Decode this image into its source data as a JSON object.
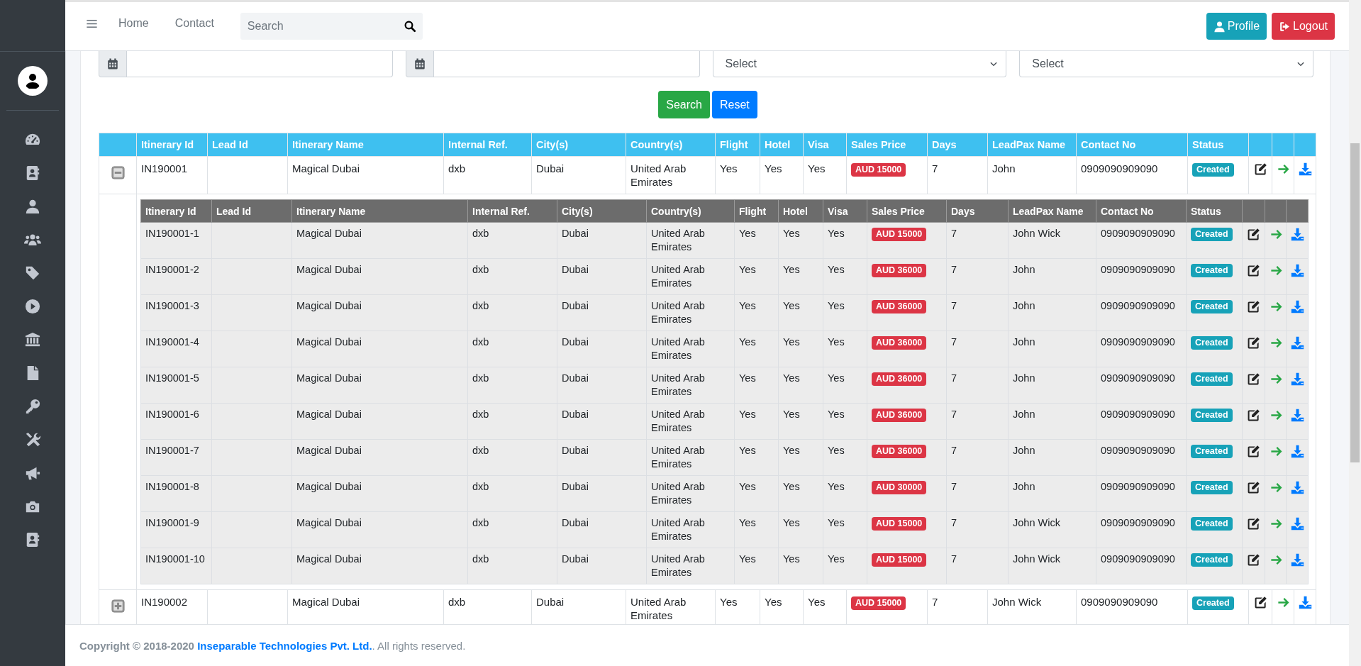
{
  "navbar": {
    "links": [
      "Home",
      "Contact"
    ],
    "search": {
      "placeholder": "Search"
    },
    "buttons": [
      {
        "label": "Profile",
        "kind": "profile"
      },
      {
        "label": "Logout",
        "kind": "logout"
      }
    ]
  },
  "filters": {
    "selects": [
      {
        "value": "Select"
      },
      {
        "value": "Select"
      }
    ],
    "buttons": [
      {
        "label": "Search",
        "kind": "search"
      },
      {
        "label": "Reset",
        "kind": "reset"
      }
    ]
  },
  "table": {
    "columns": [
      "Itinerary Id",
      "Lead Id",
      "Itinerary Name",
      "Internal Ref.",
      "City(s)",
      "Country(s)",
      "Flight",
      "Hotel",
      "Visa",
      "Sales Price",
      "Days",
      "LeadPax Name",
      "Contact No",
      "Status"
    ],
    "rows": [
      {
        "itinerary_id": "IN190001",
        "itinerary_name": "Magical Dubai",
        "internal_ref": "dxb",
        "cities": "Dubai",
        "country": "United Arab Emirates",
        "flight": "Yes",
        "hotel": "Yes",
        "visa": "Yes",
        "sales_price": "AUD 15000",
        "days": "7",
        "leadpax_name": "John",
        "contact_no": "0909090909090",
        "status": "Created",
        "expanded": true,
        "sub_table": {
          "columns": [
            "Itinerary Id",
            "Lead Id",
            "Itinerary Name",
            "Internal Ref.",
            "City(s)",
            "Country(s)",
            "Flight",
            "Hotel",
            "Visa",
            "Sales Price",
            "Days",
            "LeadPax Name",
            "Contact No",
            "Status"
          ],
          "rows": [
            {
              "itinerary_id": "IN190001-1",
              "itinerary_name": "Magical Dubai",
              "internal_ref": "dxb",
              "cities": "Dubai",
              "country": "United Arab Emirates",
              "flight": "Yes",
              "hotel": "Yes",
              "visa": "Yes",
              "sales_price": "AUD 15000",
              "days": "7",
              "leadpax_name": "John Wick",
              "contact_no": "0909090909090",
              "status": "Created"
            },
            {
              "itinerary_id": "IN190001-2",
              "itinerary_name": "Magical Dubai",
              "internal_ref": "dxb",
              "cities": "Dubai",
              "country": "United Arab Emirates",
              "flight": "Yes",
              "hotel": "Yes",
              "visa": "Yes",
              "sales_price": "AUD 36000",
              "days": "7",
              "leadpax_name": "John",
              "contact_no": "0909090909090",
              "status": "Created"
            },
            {
              "itinerary_id": "IN190001-3",
              "itinerary_name": "Magical Dubai",
              "internal_ref": "dxb",
              "cities": "Dubai",
              "country": "United Arab Emirates",
              "flight": "Yes",
              "hotel": "Yes",
              "visa": "Yes",
              "sales_price": "AUD 36000",
              "days": "7",
              "leadpax_name": "John",
              "contact_no": "0909090909090",
              "status": "Created"
            },
            {
              "itinerary_id": "IN190001-4",
              "itinerary_name": "Magical Dubai",
              "internal_ref": "dxb",
              "cities": "Dubai",
              "country": "United Arab Emirates",
              "flight": "Yes",
              "hotel": "Yes",
              "visa": "Yes",
              "sales_price": "AUD 36000",
              "days": "7",
              "leadpax_name": "John",
              "contact_no": "0909090909090",
              "status": "Created"
            },
            {
              "itinerary_id": "IN190001-5",
              "itinerary_name": "Magical Dubai",
              "internal_ref": "dxb",
              "cities": "Dubai",
              "country": "United Arab Emirates",
              "flight": "Yes",
              "hotel": "Yes",
              "visa": "Yes",
              "sales_price": "AUD 36000",
              "days": "7",
              "leadpax_name": "John",
              "contact_no": "0909090909090",
              "status": "Created"
            },
            {
              "itinerary_id": "IN190001-6",
              "itinerary_name": "Magical Dubai",
              "internal_ref": "dxb",
              "cities": "Dubai",
              "country": "United Arab Emirates",
              "flight": "Yes",
              "hotel": "Yes",
              "visa": "Yes",
              "sales_price": "AUD 36000",
              "days": "7",
              "leadpax_name": "John",
              "contact_no": "0909090909090",
              "status": "Created"
            },
            {
              "itinerary_id": "IN190001-7",
              "itinerary_name": "Magical Dubai",
              "internal_ref": "dxb",
              "cities": "Dubai",
              "country": "United Arab Emirates",
              "flight": "Yes",
              "hotel": "Yes",
              "visa": "Yes",
              "sales_price": "AUD 36000",
              "days": "7",
              "leadpax_name": "John",
              "contact_no": "0909090909090",
              "status": "Created"
            },
            {
              "itinerary_id": "IN190001-8",
              "itinerary_name": "Magical Dubai",
              "internal_ref": "dxb",
              "cities": "Dubai",
              "country": "United Arab Emirates",
              "flight": "Yes",
              "hotel": "Yes",
              "visa": "Yes",
              "sales_price": "AUD 30000",
              "days": "7",
              "leadpax_name": "John",
              "contact_no": "0909090909090",
              "status": "Created"
            },
            {
              "itinerary_id": "IN190001-9",
              "itinerary_name": "Magical Dubai",
              "internal_ref": "dxb",
              "cities": "Dubai",
              "country": "United Arab Emirates",
              "flight": "Yes",
              "hotel": "Yes",
              "visa": "Yes",
              "sales_price": "AUD 15000",
              "days": "7",
              "leadpax_name": "John Wick",
              "contact_no": "0909090909090",
              "status": "Created"
            },
            {
              "itinerary_id": "IN190001-10",
              "itinerary_name": "Magical Dubai",
              "internal_ref": "dxb",
              "cities": "Dubai",
              "country": "United Arab Emirates",
              "flight": "Yes",
              "hotel": "Yes",
              "visa": "Yes",
              "sales_price": "AUD 15000",
              "days": "7",
              "leadpax_name": "John Wick",
              "contact_no": "0909090909090",
              "status": "Created"
            }
          ]
        }
      },
      {
        "itinerary_id": "IN190002",
        "itinerary_name": "Magical Dubai",
        "internal_ref": "dxb",
        "cities": "Dubai",
        "country": "United Arab Emirates",
        "flight": "Yes",
        "hotel": "Yes",
        "visa": "Yes",
        "sales_price": "AUD 15000",
        "days": "7",
        "leadpax_name": "John Wick",
        "contact_no": "0909090909090",
        "status": "Created",
        "expanded": false
      }
    ]
  },
  "footer": {
    "prefix": "**Copyright © 2018-2020** ",
    "link": "Inseparable Technologies Pvt. Ltd.",
    "suffix": ". All rights reserved."
  }
}
